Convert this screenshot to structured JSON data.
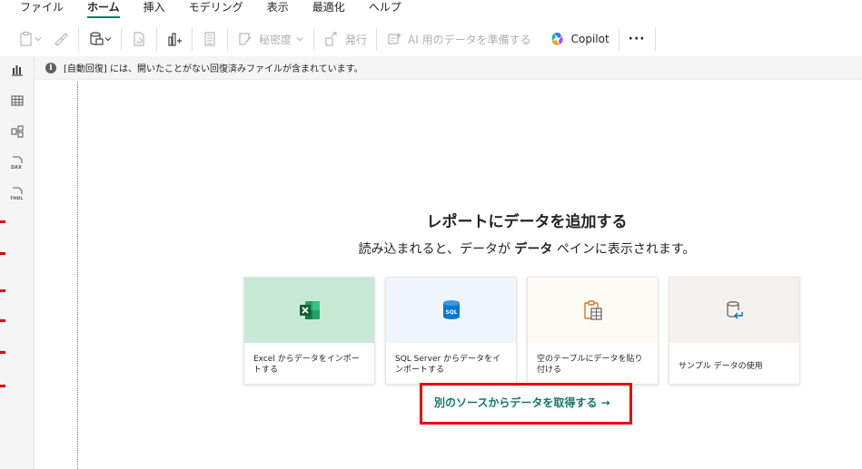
{
  "menu": {
    "items": [
      "ファイル",
      "ホーム",
      "挿入",
      "モデリング",
      "表示",
      "最適化",
      "ヘルプ"
    ],
    "active_index": 1
  },
  "ribbon": {
    "sensitivity_label": "秘密度",
    "publish_label": "発行",
    "prepare_ai_label": "AI 用のデータを準備する",
    "copilot_label": "Copilot",
    "more_label": "···"
  },
  "infobar": {
    "icon": "i",
    "text": "[自動回復] には、開いたことがない回復済みファイルが含まれています。"
  },
  "main": {
    "heading": "レポートにデータを追加する",
    "subheading_pre": "読み込まれると、データが ",
    "subheading_bold": "データ",
    "subheading_post": " ペインに表示されます。",
    "cards": [
      {
        "label": "Excel からデータをインポートする",
        "bg": "#c8e8d6",
        "icon": "excel-icon"
      },
      {
        "label": "SQL Server からデータをインポートする",
        "bg": "#eef5fc",
        "icon": "sql-server-icon"
      },
      {
        "label": "空のテーブルにデータを貼り付ける",
        "bg": "#fcfaf2",
        "icon": "paste-table-icon"
      },
      {
        "label": "サンプル データの使用",
        "bg": "#f3f2f1",
        "icon": "sample-data-icon"
      }
    ],
    "more_sources_link": "別のソースからデータを取得する →"
  },
  "colors": {
    "accent": "#117865",
    "highlight": "#e8000b"
  }
}
